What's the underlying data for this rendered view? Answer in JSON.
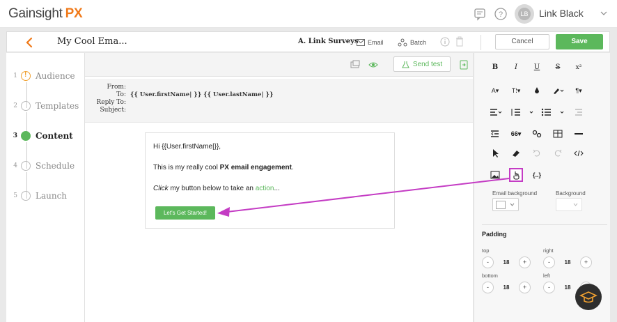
{
  "app": {
    "logo_text": "Gainsight",
    "logo_suffix": "PX",
    "user_initials": "LB",
    "user_name": "Link Black"
  },
  "editor": {
    "title": "My Cool Ema...",
    "survey_label": "A. Link Surveys",
    "email_label": "Email",
    "batch_label": "Batch",
    "cancel_label": "Cancel",
    "save_label": "Save"
  },
  "steps": [
    {
      "num": "1",
      "label": "Audience"
    },
    {
      "num": "2",
      "label": "Templates"
    },
    {
      "num": "3",
      "label": "Content"
    },
    {
      "num": "4",
      "label": "Schedule"
    },
    {
      "num": "5",
      "label": "Launch"
    }
  ],
  "preview": {
    "send_test_label": "Send test"
  },
  "headers": {
    "from_label": "From:",
    "to_label": "To:",
    "to_value": "{{ User.firstName| }} {{ User.lastName| }}",
    "reply_label": "Reply To:",
    "subject_label": "Subject:"
  },
  "email_body": {
    "greeting": "Hi {{User.firstName|}},",
    "line2_pre": "This is my really cool ",
    "line2_bold": "PX email engagement",
    "line2_post": ".",
    "line3_em": "Click",
    "line3_mid": " my button below to take an ",
    "line3_link": "action",
    "line3_post": "...",
    "cta_label": "Let's Get Started!"
  },
  "toolbar": {
    "bold": "B",
    "italic": "I",
    "underline": "U",
    "strike": "S",
    "superscript": "x²",
    "font_color": "A",
    "font_size": "T⁞",
    "paragraph": "¶",
    "quote": "66",
    "variables": "{..}"
  },
  "right_panel": {
    "email_bg_label": "Email background",
    "bg_label": "Background",
    "padding_title": "Padding",
    "top_label": "top",
    "right_label": "right",
    "bottom_label": "bottom",
    "left_label": "left",
    "top_value": "18",
    "right_value": "18",
    "bottom_value": "18",
    "left_value": "18",
    "minus": "-",
    "plus": "+"
  },
  "colors": {
    "accent_green": "#5cb85c",
    "brand_orange": "#f07a1a",
    "annotation_magenta": "#c43cc4"
  }
}
